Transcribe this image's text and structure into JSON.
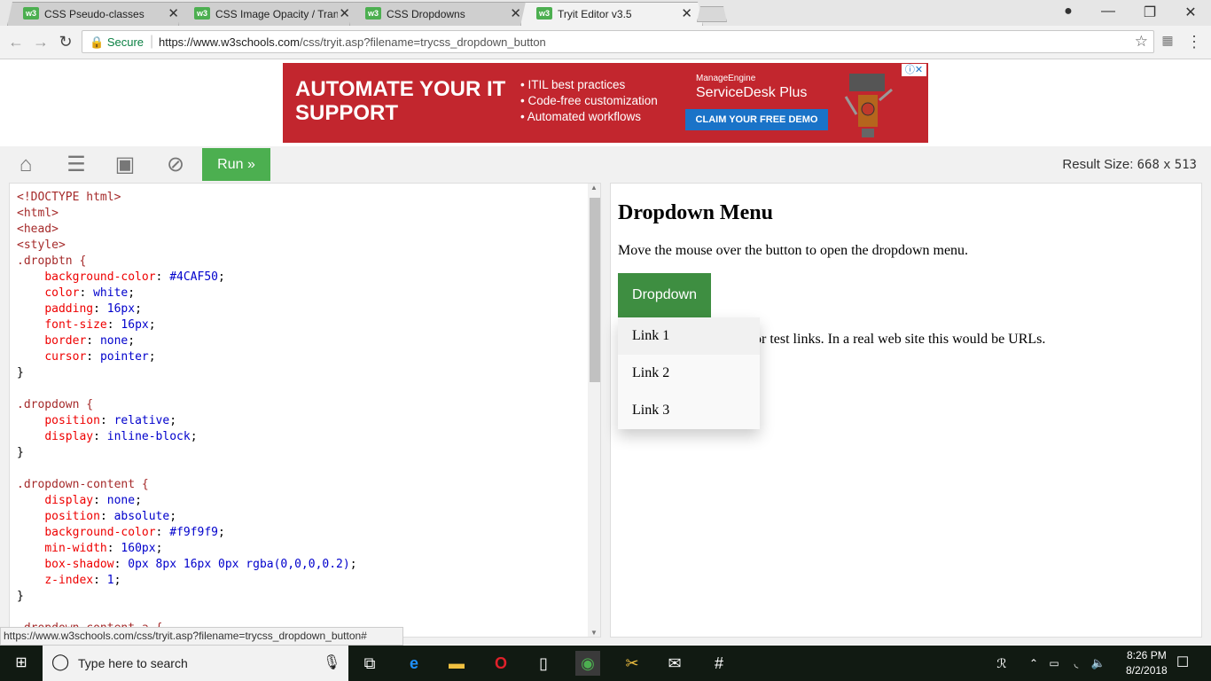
{
  "browser": {
    "tabs": [
      {
        "title": "CSS Pseudo-classes",
        "favicon": "w3"
      },
      {
        "title": "CSS Image Opacity / Tran",
        "favicon": "w3"
      },
      {
        "title": "CSS Dropdowns",
        "favicon": "w3"
      },
      {
        "title": "Tryit Editor v3.5",
        "favicon": "w3",
        "active": true
      }
    ],
    "secure_label": "Secure",
    "url_host": "https://www.w3schools.com",
    "url_path": "/css/tryit.asp?filename=trycss_dropdown_button",
    "status_url": "https://www.w3schools.com/css/tryit.asp?filename=trycss_dropdown_button#"
  },
  "ad": {
    "headline": "AUTOMATE YOUR IT SUPPORT",
    "bullets": [
      "• ITIL best practices",
      "• Code-free customization",
      "• Automated workflows"
    ],
    "brand": "ManageEngine",
    "product": "ServiceDesk Plus",
    "cta": "CLAIM YOUR FREE DEMO",
    "close_label": "ⓘ✕"
  },
  "toolbar": {
    "run_label": "Run »",
    "result_size_label": "Result Size:",
    "result_width": "668",
    "result_x": "x",
    "result_height": "513"
  },
  "editor": {
    "code_lines": [
      "<!DOCTYPE html>",
      "<html>",
      "<head>",
      "<style>",
      ".dropbtn {",
      "    background-color: #4CAF50;",
      "    color: white;",
      "    padding: 16px;",
      "    font-size: 16px;",
      "    border: none;",
      "    cursor: pointer;",
      "}",
      "",
      ".dropdown {",
      "    position: relative;",
      "    display: inline-block;",
      "}",
      "",
      ".dropdown-content {",
      "    display: none;",
      "    position: absolute;",
      "    background-color: #f9f9f9;",
      "    min-width: 160px;",
      "    box-shadow: 0px 8px 16px 0px rgba(0,0,0,0.2);",
      "    z-index: 1;",
      "}",
      "",
      ".dropdown-content a {"
    ]
  },
  "result": {
    "heading": "Dropdown Menu",
    "intro": "Move the mouse over the button to open the dropdown menu.",
    "button_label": "Dropdown",
    "links": [
      "Link 1",
      "Link 2",
      "Link 3"
    ],
    "note": "or test links. In a real web site this would be URLs."
  },
  "taskbar": {
    "search_placeholder": "Type here to search",
    "time": "8:26 PM",
    "date": "8/2/2018"
  }
}
